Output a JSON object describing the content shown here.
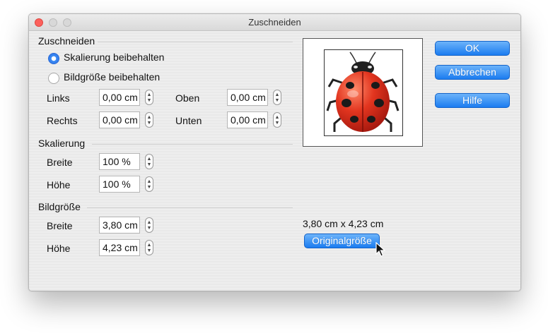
{
  "window": {
    "title": "Zuschneiden"
  },
  "crop": {
    "heading": "Zuschneiden",
    "radio_keep_scale": "Skalierung beibehalten",
    "radio_keep_size": "Bildgröße beibehalten",
    "selected": "keep_scale",
    "left_label": "Links",
    "left_value": "0,00 cm",
    "top_label": "Oben",
    "top_value": "0,00 cm",
    "right_label": "Rechts",
    "right_value": "0,00 cm",
    "bottom_label": "Unten",
    "bottom_value": "0,00 cm"
  },
  "scale": {
    "heading": "Skalierung",
    "width_label": "Breite",
    "width_value": "100 %",
    "height_label": "Höhe",
    "height_value": "100 %"
  },
  "imagesize": {
    "heading": "Bildgröße",
    "width_label": "Breite",
    "width_value": "3,80 cm",
    "height_label": "Höhe",
    "height_value": "4,23 cm"
  },
  "original": {
    "size_text": "3,80 cm x 4,23 cm",
    "button_label": "Originalgröße"
  },
  "buttons": {
    "ok": "OK",
    "cancel": "Abbrechen",
    "help": "Hilfe"
  },
  "colors": {
    "accent": "#1b7cf0",
    "close": "#fc605c",
    "ladybug_red": "#d8261c"
  },
  "icons": {
    "preview": "ladybug-image",
    "cursor": "arrow-pointer-icon"
  }
}
